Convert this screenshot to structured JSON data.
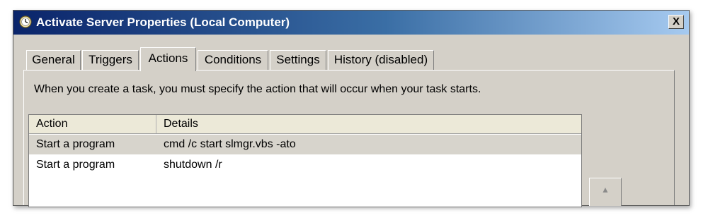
{
  "window": {
    "title": "Activate Server Properties (Local Computer)",
    "close_label": "X"
  },
  "tabs": [
    {
      "label": "General",
      "active": false
    },
    {
      "label": "Triggers",
      "active": false
    },
    {
      "label": "Actions",
      "active": true
    },
    {
      "label": "Conditions",
      "active": false
    },
    {
      "label": "Settings",
      "active": false
    },
    {
      "label": "History (disabled)",
      "active": false
    }
  ],
  "actions_tab": {
    "instruction": "When you create a task, you must specify the action that will occur when your task starts.",
    "columns": [
      "Action",
      "Details"
    ],
    "rows": [
      {
        "action": "Start a program",
        "details": "cmd /c start slmgr.vbs -ato",
        "selected": true
      },
      {
        "action": "Start a program",
        "details": "shutdown /r",
        "selected": false
      }
    ],
    "move_up_icon": "up-arrow-icon"
  },
  "colors": {
    "title_bar_start": "#0a246a",
    "title_bar_end": "#a6caf0",
    "dialog_background": "#d4d0c8",
    "selected_row": "#d7d4cc"
  }
}
